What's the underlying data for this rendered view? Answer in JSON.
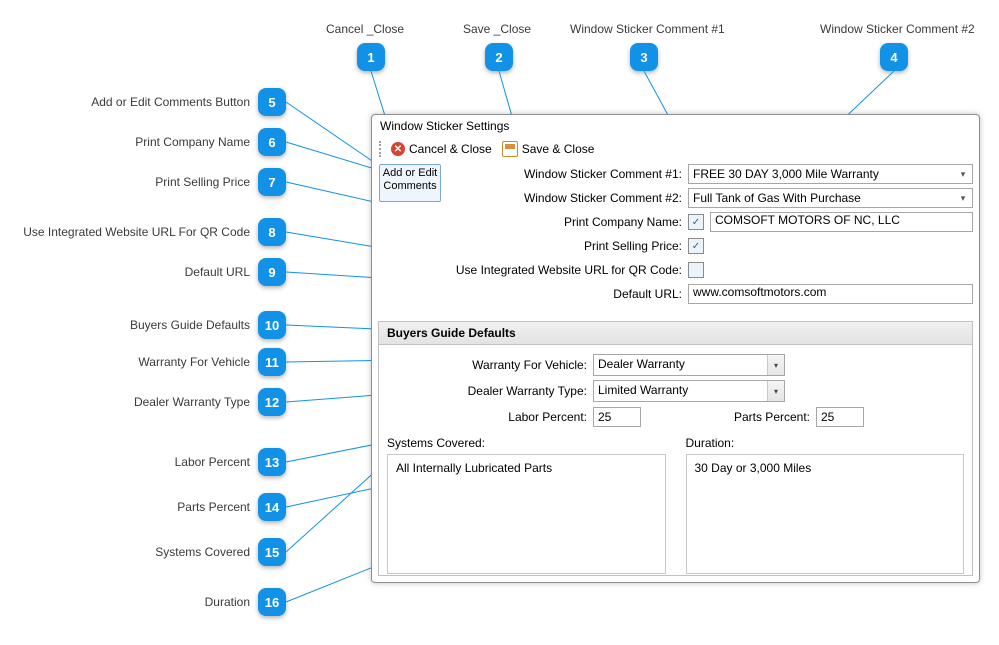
{
  "top_callouts": [
    {
      "n": "1",
      "label": "Cancel _Close"
    },
    {
      "n": "2",
      "label": "Save _Close"
    },
    {
      "n": "3",
      "label": "Window Sticker Comment #1"
    },
    {
      "n": "4",
      "label": "Window Sticker Comment #2"
    }
  ],
  "left_callouts": [
    {
      "n": "5",
      "label": "Add or Edit Comments Button"
    },
    {
      "n": "6",
      "label": "Print Company Name"
    },
    {
      "n": "7",
      "label": "Print Selling Price"
    },
    {
      "n": "8",
      "label": "Use Integrated Website URL For QR Code"
    },
    {
      "n": "9",
      "label": "Default URL"
    },
    {
      "n": "10",
      "label": "Buyers Guide Defaults"
    },
    {
      "n": "11",
      "label": "Warranty For Vehicle"
    },
    {
      "n": "12",
      "label": "Dealer Warranty Type"
    },
    {
      "n": "13",
      "label": "Labor Percent"
    },
    {
      "n": "14",
      "label": "Parts Percent"
    },
    {
      "n": "15",
      "label": "Systems Covered"
    },
    {
      "n": "16",
      "label": "Duration"
    }
  ],
  "panel": {
    "title": "Window Sticker Settings",
    "toolbar": {
      "cancel": "Cancel & Close",
      "save": "Save & Close"
    },
    "addedit": "Add or Edit Comments",
    "labels": {
      "c1": "Window Sticker Comment #1:",
      "c2": "Window Sticker Comment #2:",
      "company": "Print Company Name:",
      "sellprice": "Print Selling Price:",
      "qr": "Use Integrated Website URL for QR Code:",
      "url": "Default URL:"
    },
    "values": {
      "c1": "FREE 30 DAY 3,000 Mile Warranty",
      "c2": "Full Tank of Gas With Purchase",
      "company": "COMSOFT MOTORS OF NC, LLC",
      "company_chk": "✓",
      "sellprice_chk": "✓",
      "qr_chk": "",
      "url": "www.comsoftmotors.com"
    },
    "section": {
      "title": "Buyers Guide Defaults",
      "labels": {
        "wfv": "Warranty For Vehicle:",
        "dwt": "Dealer Warranty Type:",
        "labor": "Labor Percent:",
        "parts": "Parts Percent:",
        "sys": "Systems Covered:",
        "dur": "Duration:"
      },
      "values": {
        "wfv": "Dealer Warranty",
        "dwt": "Limited Warranty",
        "labor": "25",
        "parts": "25",
        "sys": "All Internally Lubricated Parts",
        "dur": "30 Day or 3,000 Miles"
      }
    }
  }
}
